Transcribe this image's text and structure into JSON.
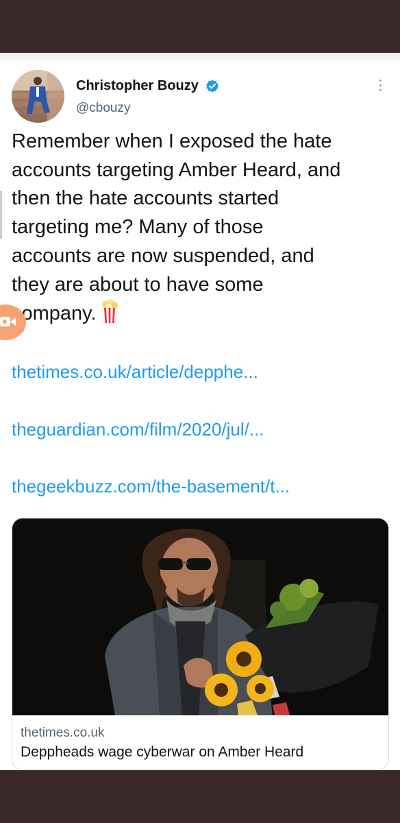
{
  "tweet": {
    "author": {
      "name": "Christopher Bouzy",
      "handle": "@cbouzy",
      "verified": true
    },
    "text_lines": [
      "Remember when I exposed the hate",
      "accounts targeting Amber Heard, and",
      "then the hate accounts started",
      "targeting me? Many of those",
      "accounts are now suspended, and",
      "they are about to have some",
      "company."
    ],
    "links": [
      "thetimes.co.uk/article/depphe...",
      "theguardian.com/film/2020/jul/...",
      "thegeekbuzz.com/the-basement/t..."
    ],
    "card": {
      "domain": "thetimes.co.uk",
      "title": "Deppheads wage cyberwar on Amber Heard"
    }
  },
  "colors": {
    "link": "#1d9bf0",
    "verified": "#1d9bf0",
    "text": "#0f1419",
    "secondary": "#536471",
    "status_bar": "#3a2727"
  },
  "icons": [
    "verified-badge-icon",
    "more-options-icon",
    "popcorn-icon",
    "screen-record-icon"
  ]
}
